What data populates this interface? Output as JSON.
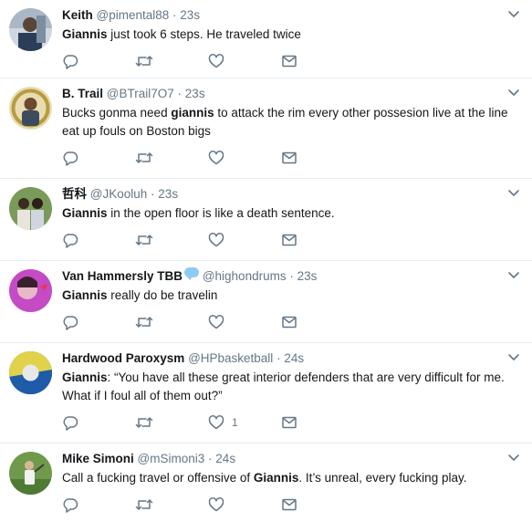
{
  "tweets": [
    {
      "name": "Keith",
      "handle": "@pimental88",
      "time": "23s",
      "text": [
        {
          "t": "Giannis",
          "b": true
        },
        {
          "t": " just took 6 steps. He traveled twice",
          "b": false
        }
      ],
      "likes": ""
    },
    {
      "name": "B. Trail",
      "handle": "@BTrail7O7",
      "time": "23s",
      "text": [
        {
          "t": "Bucks gonma need ",
          "b": false
        },
        {
          "t": "giannis",
          "b": true
        },
        {
          "t": " to attack the rim every other possesion live at the line eat up fouls on Boston bigs",
          "b": false
        }
      ],
      "likes": ""
    },
    {
      "name": "哲科",
      "handle": "@JKooluh",
      "time": "23s",
      "text": [
        {
          "t": "Giannis",
          "b": true
        },
        {
          "t": " in the open floor is like a death sentence.",
          "b": false
        }
      ],
      "likes": ""
    },
    {
      "name": "Van Hammersly TBB",
      "handle": "@highondrums",
      "time": "23s",
      "text": [
        {
          "t": "Giannis",
          "b": true
        },
        {
          "t": " really do be travelin",
          "b": false
        }
      ],
      "likes": ""
    },
    {
      "name": "Hardwood Paroxysm",
      "handle": "@HPbasketball",
      "time": "24s",
      "text": [
        {
          "t": "Giannis",
          "b": true
        },
        {
          "t": ": “You have all these great interior defenders that are very difficult for me. What if I foul all of them out?”",
          "b": false
        }
      ],
      "likes": "1"
    },
    {
      "name": "Mike Simoni",
      "handle": "@mSimoni3",
      "time": "24s",
      "text": [
        {
          "t": "Call a fucking travel or offensive of ",
          "b": false
        },
        {
          "t": "Giannis",
          "b": true
        },
        {
          "t": ". It’s unreal, every fucking play.",
          "b": false
        }
      ],
      "likes": ""
    }
  ],
  "separator": "·",
  "icons": {
    "reply": "reply-icon",
    "retweet": "retweet-icon",
    "like": "heart-icon",
    "message": "envelope-icon",
    "caret": "chevron-down-icon"
  },
  "colors": {
    "text": "#14171a",
    "muted": "#657786",
    "divider": "#e6ecf0"
  }
}
